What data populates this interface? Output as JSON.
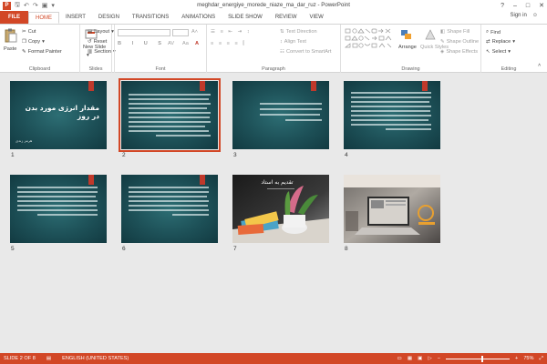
{
  "window": {
    "title": "meghdar_energiye_morede_niaze_ma_dar_ruz - PowerPoint",
    "app_icon": "P",
    "sign_in": "Sign in",
    "controls": [
      "?",
      "‒",
      "□",
      "✕"
    ]
  },
  "tabs": [
    {
      "label": "FILE"
    },
    {
      "label": "HOME"
    },
    {
      "label": "INSERT"
    },
    {
      "label": "DESIGN"
    },
    {
      "label": "TRANSITIONS"
    },
    {
      "label": "ANIMATIONS"
    },
    {
      "label": "SLIDE SHOW"
    },
    {
      "label": "REVIEW"
    },
    {
      "label": "VIEW"
    }
  ],
  "ribbon": {
    "clipboard": {
      "label": "Clipboard",
      "paste": "Paste",
      "cut": "Cut",
      "copy": "Copy",
      "format_painter": "Format Painter"
    },
    "slides": {
      "label": "Slides",
      "new_slide": "New Slide",
      "layout": "Layout",
      "reset": "Reset",
      "section": "Section"
    },
    "font": {
      "label": "Font"
    },
    "paragraph": {
      "label": "Paragraph",
      "text_direction": "Text Direction",
      "align_text": "Align Text",
      "convert_smartart": "Convert to SmartArt"
    },
    "drawing": {
      "label": "Drawing",
      "arrange": "Arrange",
      "quick_styles": "Quick Styles",
      "shape_fill": "Shape Fill",
      "shape_outline": "Shape Outline",
      "shape_effects": "Shape Effects"
    },
    "editing": {
      "label": "Editing",
      "find": "Find",
      "replace": "Replace",
      "select": "Select"
    }
  },
  "slides": [
    {
      "num": "1",
      "title": "مقدار انرژی مورد بدن در روز",
      "subtitle": "هرمز زندی"
    },
    {
      "num": "2"
    },
    {
      "num": "3"
    },
    {
      "num": "4"
    },
    {
      "num": "5"
    },
    {
      "num": "6"
    },
    {
      "num": "7",
      "title": "تقدیم به استاد"
    },
    {
      "num": "8"
    }
  ],
  "status": {
    "slide_info": "SLIDE 2 OF 8",
    "language": "ENGLISH (UNITED STATES)",
    "zoom": "75%",
    "zoom_fraction": 0.55
  },
  "colors": {
    "accent": "#d24726",
    "slide_bg": "#1d5057"
  }
}
